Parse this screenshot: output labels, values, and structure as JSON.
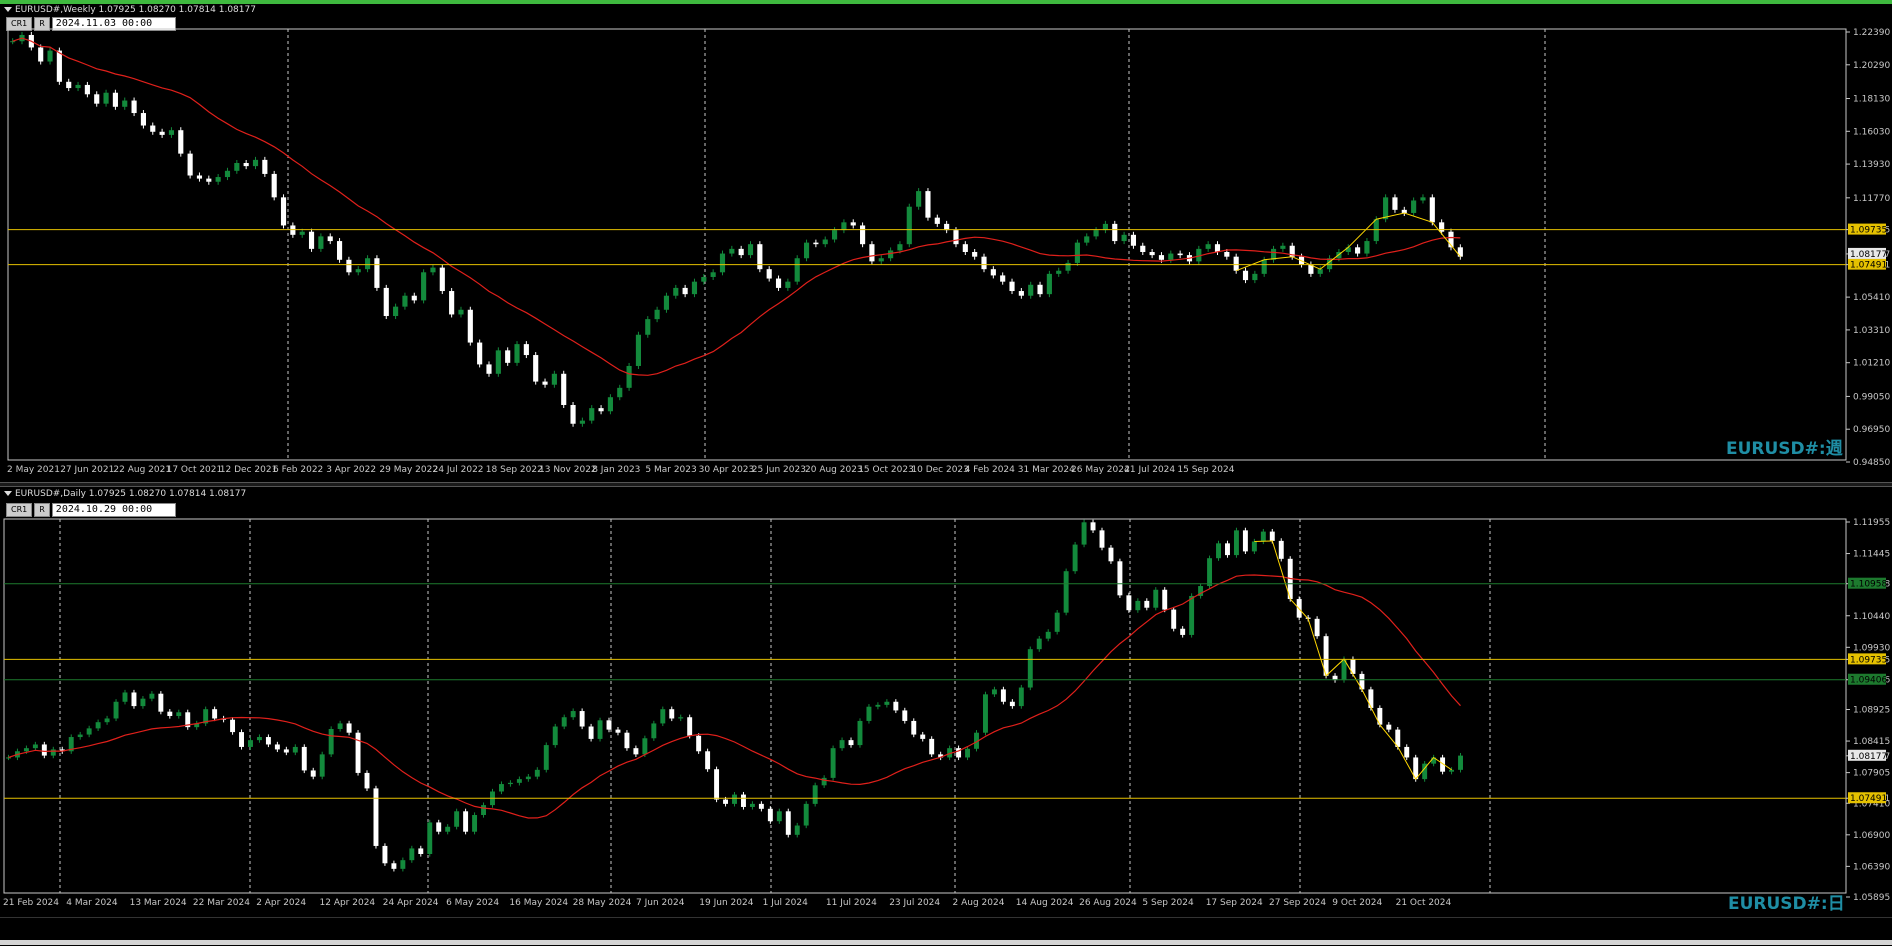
{
  "colors": {
    "bull": "#138a3c",
    "bear": "#ffffff",
    "ma": "#e0201b",
    "hline": "#e5c100",
    "greenline": "#1d7a2e",
    "grid": "#c8c8c8",
    "axis": "#c8c8c8",
    "zigzag": "#ffd700",
    "watermark": "#1f8ea5"
  },
  "top": {
    "header": "EURUSD#,Weekly  1.07925 1.08270 1.07814 1.08177",
    "btn_cr": "CR1",
    "btn_r": "R",
    "date": "2024.11.03 00:00",
    "watermark": "EURUSD#:週",
    "price_ticks": [
      "1.22390",
      "1.20290",
      "1.18130",
      "1.16030",
      "1.13930",
      "1.11770",
      "1.09735",
      "1.08177",
      "1.07491",
      "1.05410",
      "1.03310",
      "1.01210",
      "0.99050",
      "0.96950",
      "0.94850"
    ],
    "date_ticks": [
      "2 May 2021",
      "27 Jun 2021",
      "22 Aug 2021",
      "17 Oct 2021",
      "12 Dec 2021",
      "6 Feb 2022",
      "3 Apr 2022",
      "29 May 2022",
      "24 Jul 2022",
      "18 Sep 2022",
      "13 Nov 2022",
      "8 Jan 2023",
      "5 Mar 2023",
      "30 Apr 2023",
      "25 Jun 2023",
      "20 Aug 2023",
      "15 Oct 2023",
      "10 Dec 2023",
      "4 Feb 2024",
      "31 Mar 2024",
      "26 May 2024",
      "21 Jul 2024",
      "15 Sep 2024"
    ],
    "labels": {
      "upper": "1.09735",
      "current": "1.08177",
      "lower": "1.07491"
    }
  },
  "bottom": {
    "header": "EURUSD#,Daily  1.07925 1.08270 1.07814 1.08177",
    "btn_cr": "CR1",
    "btn_r": "R",
    "date": "2024.10.29 00:00",
    "watermark": "EURUSD#:日",
    "price_ticks": [
      "1.11955",
      "1.11445",
      "1.10958",
      "1.10440",
      "1.09930",
      "1.09735",
      "1.09406",
      "1.08925",
      "1.08415",
      "1.08177",
      "1.07905",
      "1.07491",
      "1.07410",
      "1.06900",
      "1.06390",
      "1.05895"
    ],
    "date_ticks": [
      "21 Feb 2024",
      "4 Mar 2024",
      "13 Mar 2024",
      "22 Mar 2024",
      "2 Apr 2024",
      "12 Apr 2024",
      "24 Apr 2024",
      "6 May 2024",
      "16 May 2024",
      "28 May 2024",
      "7 Jun 2024",
      "19 Jun 2024",
      "1 Jul 2024",
      "11 Jul 2024",
      "23 Jul 2024",
      "2 Aug 2024",
      "14 Aug 2024",
      "26 Aug 2024",
      "5 Sep 2024",
      "17 Sep 2024",
      "27 Sep 2024",
      "9 Oct 2024",
      "21 Oct 2024"
    ],
    "labels": {
      "green_upper": "1.10958",
      "upper": "1.09735",
      "green_lower": "1.09406",
      "current": "1.08177",
      "lower": "1.07491"
    }
  },
  "chart_data": [
    {
      "type": "candlestick",
      "title": "EURUSD#,Weekly",
      "ylim": [
        0.9485,
        1.2239
      ],
      "close_series": [
        1.218,
        1.222,
        1.214,
        1.205,
        1.212,
        1.192,
        1.188,
        1.19,
        1.184,
        1.178,
        1.185,
        1.176,
        1.18,
        1.172,
        1.164,
        1.16,
        1.158,
        1.161,
        1.146,
        1.132,
        1.13,
        1.128,
        1.131,
        1.135,
        1.14,
        1.138,
        1.142,
        1.133,
        1.118,
        1.1,
        1.094,
        1.096,
        1.085,
        1.093,
        1.09,
        1.078,
        1.07,
        1.072,
        1.079,
        1.06,
        1.042,
        1.048,
        1.055,
        1.052,
        1.07,
        1.073,
        1.058,
        1.043,
        1.046,
        1.025,
        1.011,
        1.005,
        1.02,
        1.012,
        1.024,
        1.017,
        1.0,
        0.998,
        1.005,
        0.985,
        0.973,
        0.975,
        0.983,
        0.981,
        0.99,
        0.996,
        1.01,
        1.03,
        1.04,
        1.046,
        1.055,
        1.06,
        1.056,
        1.064,
        1.067,
        1.07,
        1.082,
        1.085,
        1.081,
        1.088,
        1.072,
        1.066,
        1.06,
        1.064,
        1.079,
        1.089,
        1.088,
        1.091,
        1.097,
        1.102,
        1.1,
        1.088,
        1.077,
        1.079,
        1.084,
        1.088,
        1.112,
        1.122,
        1.105,
        1.101,
        1.097,
        1.088,
        1.083,
        1.08,
        1.072,
        1.068,
        1.064,
        1.058,
        1.055,
        1.062,
        1.056,
        1.069,
        1.071,
        1.076,
        1.089,
        1.093,
        1.097,
        1.101,
        1.09,
        1.094,
        1.087,
        1.083,
        1.081,
        1.078,
        1.082,
        1.081,
        1.077,
        1.085,
        1.088,
        1.083,
        1.08,
        1.071,
        1.065,
        1.069,
        1.078,
        1.085,
        1.087,
        1.08,
        1.075,
        1.069,
        1.072,
        1.079,
        1.083,
        1.086,
        1.082,
        1.09,
        1.104,
        1.118,
        1.11,
        1.108,
        1.116,
        1.118,
        1.102,
        1.096,
        1.086,
        1.08
      ]
    },
    {
      "type": "candlestick",
      "title": "EURUSD#,Daily",
      "ylim": [
        1.05895,
        1.11955
      ],
      "close_series": [
        1.0815,
        1.0825,
        1.083,
        1.0836,
        1.0818,
        1.0828,
        1.0825,
        1.0848,
        1.0852,
        1.0862,
        1.0872,
        1.0878,
        1.0905,
        1.092,
        1.0898,
        1.091,
        1.0918,
        1.0889,
        1.0882,
        1.0888,
        1.0864,
        1.087,
        1.0893,
        1.0878,
        1.0876,
        1.0856,
        1.0832,
        1.0843,
        1.0848,
        1.0836,
        1.0828,
        1.0823,
        1.0832,
        1.0794,
        1.0784,
        1.082,
        1.0861,
        1.087,
        1.0855,
        1.079,
        1.0765,
        1.0672,
        1.0644,
        1.0635,
        1.0649,
        1.0668,
        1.0659,
        1.071,
        1.0695,
        1.0703,
        1.0728,
        1.0695,
        1.0722,
        1.0738,
        1.076,
        1.0772,
        1.0774,
        1.078,
        1.0784,
        1.0795,
        1.0835,
        1.0865,
        1.088,
        1.089,
        1.0865,
        1.0845,
        1.0875,
        1.086,
        1.0855,
        1.083,
        1.082,
        1.0846,
        1.087,
        1.0893,
        1.0878,
        1.088,
        1.085,
        1.0825,
        1.0796,
        1.0747,
        1.074,
        1.0755,
        1.0735,
        1.074,
        1.0732,
        1.0712,
        1.0728,
        1.069,
        1.0705,
        1.074,
        1.077,
        1.0782,
        1.083,
        1.0843,
        1.0835,
        1.0874,
        1.0897,
        1.09,
        1.0905,
        1.0891,
        1.0874,
        1.0852,
        1.0845,
        1.082,
        1.0815,
        1.083,
        1.0815,
        1.0829,
        1.0855,
        1.0917,
        1.0925,
        1.0905,
        1.0898,
        1.0928,
        1.099,
        1.1007,
        1.1018,
        1.1049,
        1.1116,
        1.1159,
        1.1195,
        1.1182,
        1.1154,
        1.1132,
        1.1077,
        1.1053,
        1.1068,
        1.1057,
        1.1086,
        1.1054,
        1.1023,
        1.1013,
        1.1076,
        1.1092,
        1.1137,
        1.1161,
        1.1142,
        1.1182,
        1.1148,
        1.1164,
        1.118,
        1.1165,
        1.1136,
        1.1071,
        1.1041,
        1.1039,
        1.1011,
        1.0947,
        1.094,
        1.0974,
        1.095,
        1.0925,
        1.0895,
        1.0868,
        1.086,
        1.0832,
        1.0815,
        1.078,
        1.0805,
        1.0815,
        1.0792,
        1.0795,
        1.0818
      ]
    }
  ]
}
